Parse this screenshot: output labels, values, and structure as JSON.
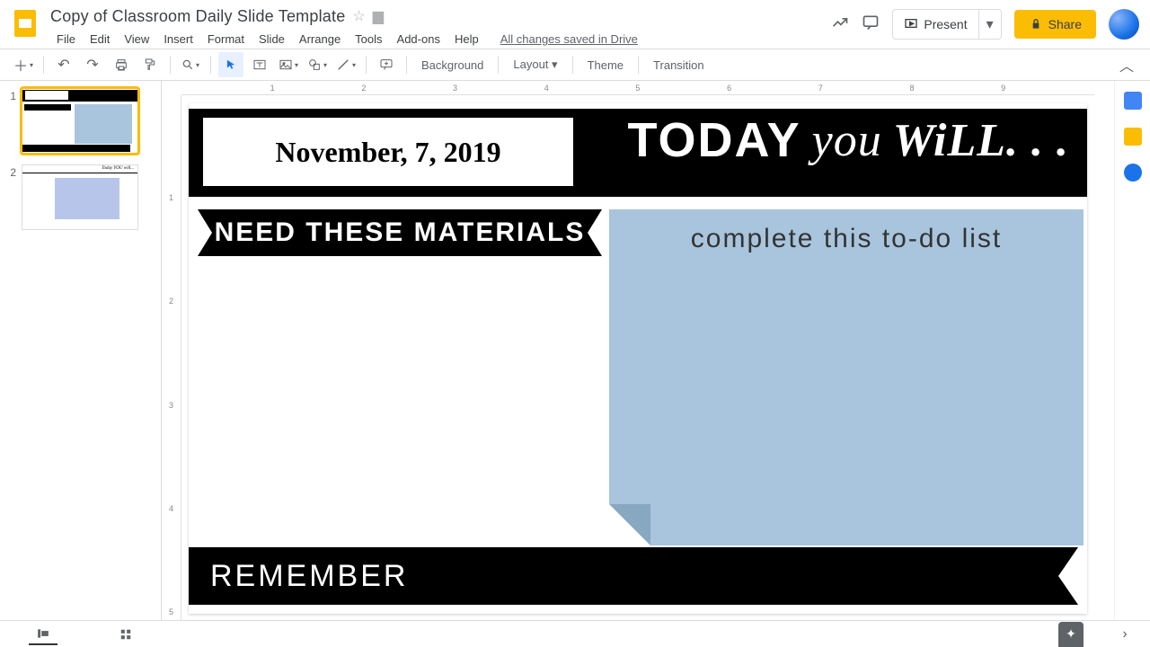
{
  "app": {
    "name": "Google Slides"
  },
  "doc": {
    "title": "Copy of Classroom Daily Slide Template"
  },
  "menu": {
    "file": "File",
    "edit": "Edit",
    "view": "View",
    "insert": "Insert",
    "format": "Format",
    "slide": "Slide",
    "arrange": "Arrange",
    "tools": "Tools",
    "addons": "Add-ons",
    "help": "Help",
    "save_status": "All changes saved in Drive"
  },
  "titlebar": {
    "present": "Present",
    "share": "Share"
  },
  "toolbar": {
    "background": "Background",
    "layout": "Layout",
    "theme": "Theme",
    "transition": "Transition"
  },
  "ruler_h": [
    "",
    "1",
    "2",
    "3",
    "4",
    "5",
    "6",
    "7",
    "8",
    "9",
    "",
    ""
  ],
  "ruler_v": [
    "",
    "1",
    "2",
    "3",
    "4",
    "5"
  ],
  "filmstrip": {
    "slides": [
      {
        "num": "1",
        "selected": true
      },
      {
        "num": "2",
        "selected": false
      }
    ]
  },
  "slide": {
    "date": "November, 7, 2019",
    "today1": "TODAY",
    "today2": "you",
    "today3": "WiLL. . .",
    "materials": "NEED THESE MATERIALS",
    "todo": "complete this to-do list",
    "remember": "REMEMBER"
  },
  "thumb2_title": "Today YOU will..."
}
